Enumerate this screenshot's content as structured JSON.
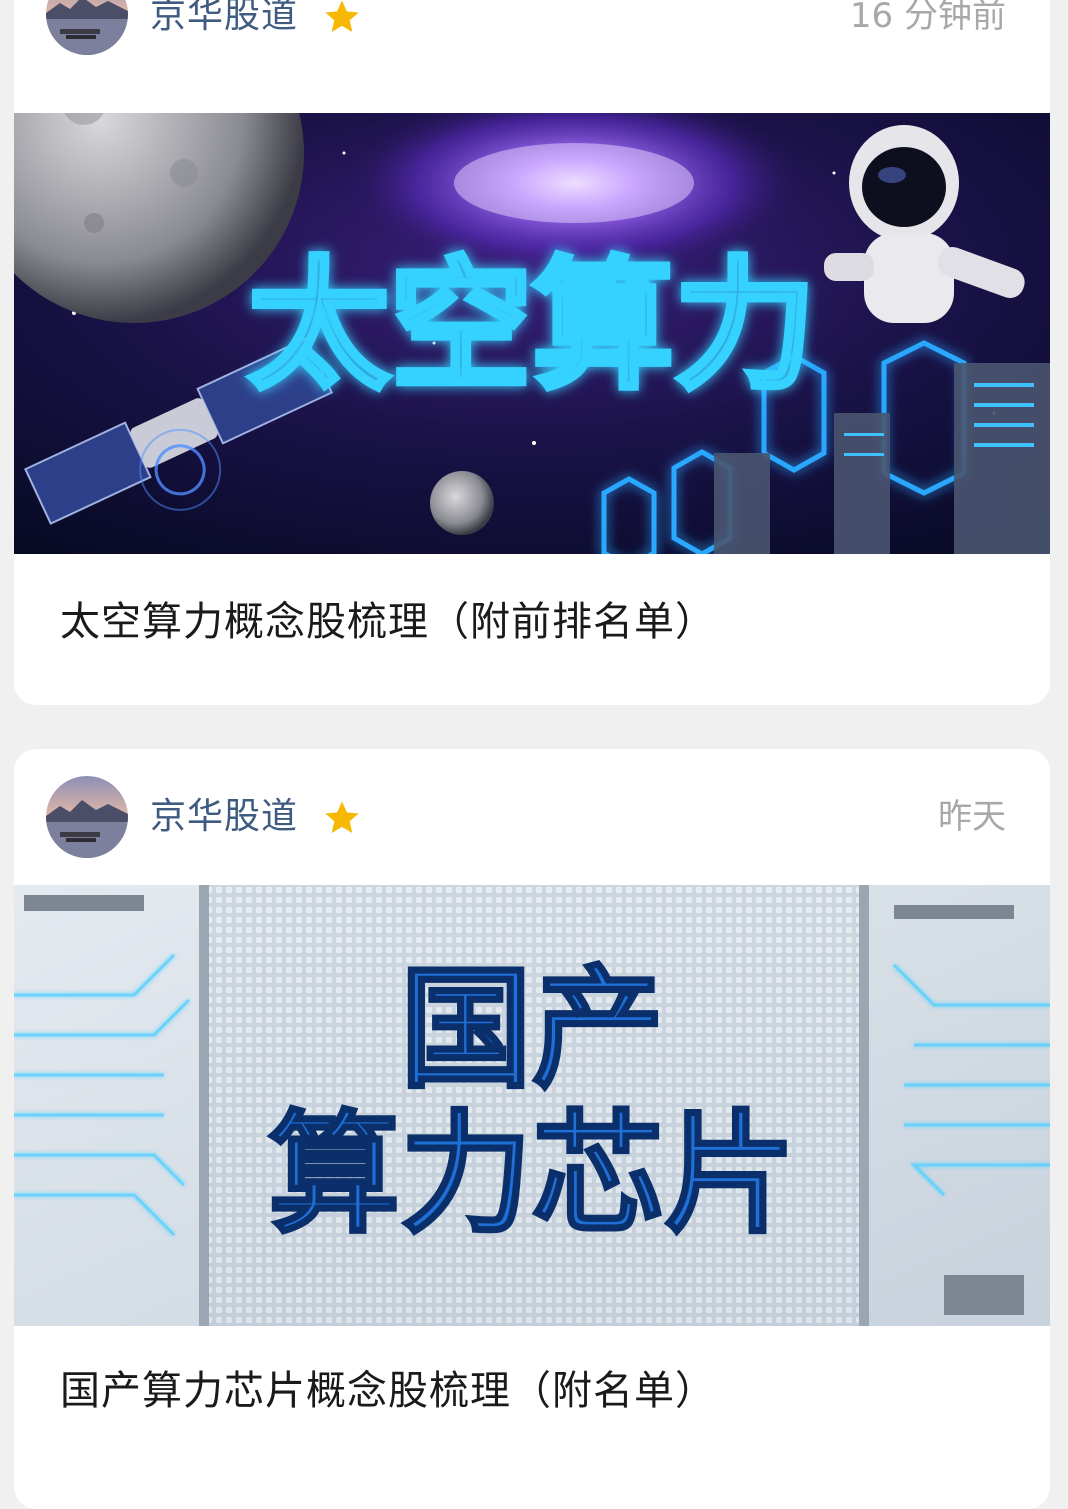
{
  "feed": [
    {
      "author": "京华股道",
      "time": "16 分钟前",
      "banner_text": "太空算力",
      "title": "太空算力概念股梳理（附前排名单）",
      "icons": [
        "avatar-landscape",
        "star-icon"
      ]
    },
    {
      "author": "京华股道",
      "time": "昨天",
      "banner_text_line1": "国产",
      "banner_text_line2": "算力芯片",
      "title": "国产算力芯片概念股梳理（附名单）",
      "icons": [
        "avatar-landscape",
        "star-icon"
      ]
    }
  ],
  "colors": {
    "author": "#3f5b80",
    "time": "#a8a8a8",
    "star": "#f6b800",
    "background": "#f0f0f0"
  }
}
